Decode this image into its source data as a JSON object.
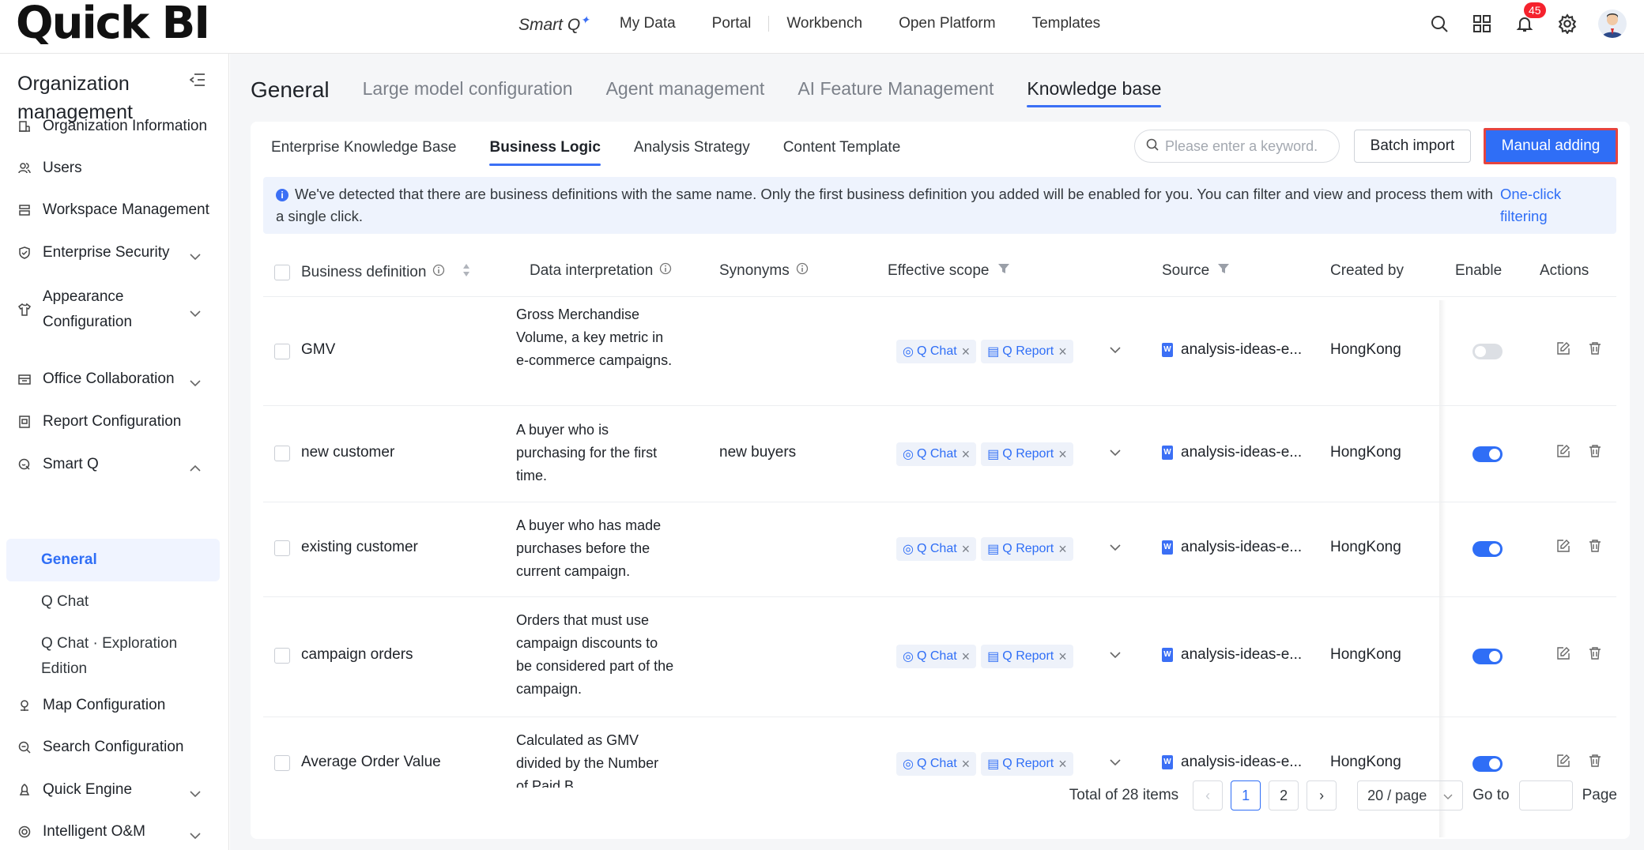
{
  "header": {
    "logo": "Quick BI",
    "smartq": "Smart Q",
    "nav": [
      "My Data",
      "Portal",
      "Workbench",
      "Open Platform",
      "Templates"
    ],
    "notification_count": "45"
  },
  "sidebar": {
    "title": "Organization management",
    "items": [
      {
        "label": "Organization Information",
        "icon": "org-icon"
      },
      {
        "label": "Users",
        "icon": "users-icon"
      },
      {
        "label": "Workspace Management",
        "icon": "workspace-icon"
      },
      {
        "label": "Enterprise Security",
        "icon": "shield-icon"
      },
      {
        "label": "Appearance Configuration",
        "icon": "shirt-icon"
      },
      {
        "label": "Office Collaboration",
        "icon": "office-icon"
      },
      {
        "label": "Report Configuration",
        "icon": "report-icon"
      },
      {
        "label": "Smart Q",
        "icon": "smartq-icon"
      },
      {
        "label": "Map Configuration",
        "icon": "map-icon"
      },
      {
        "label": "Search Configuration",
        "icon": "search-config-icon"
      },
      {
        "label": "Quick Engine",
        "icon": "engine-icon"
      },
      {
        "label": "Intelligent O&M",
        "icon": "om-icon"
      }
    ],
    "smartq_sub": [
      "General",
      "Q Chat",
      "Q Chat · Exploration Edition"
    ]
  },
  "main": {
    "tabs": [
      "General",
      "Large model configuration",
      "Agent management",
      "AI Feature Management",
      "Knowledge base"
    ],
    "active_tab": "Knowledge base",
    "subtabs": [
      "Enterprise Knowledge Base",
      "Business Logic",
      "Analysis Strategy",
      "Content Template"
    ],
    "active_subtab": "Business Logic",
    "search_placeholder": "Please enter a keyword.",
    "batch_import": "Batch import",
    "manual_adding": "Manual adding",
    "notice": "We've detected that there are business definitions with the same name. Only the first business definition you added will be enabled for you. You can filter and view and process them with a single click.",
    "notice_link": "One-click filtering",
    "columns": [
      "Business definition",
      "Data interpretation",
      "Synonyms",
      "Effective scope",
      "Source",
      "Created by",
      "Enable",
      "Actions"
    ],
    "rows": [
      {
        "name": "GMV",
        "interp": "Gross Merchandise Volume, a key metric in e-commerce campaigns.",
        "synonyms": "",
        "scope": [
          "Q Chat",
          "Q Report"
        ],
        "source": "analysis-ideas-e...",
        "created_by": "HongKong",
        "enabled": false
      },
      {
        "name": "new customer",
        "interp": "A buyer who is purchasing for the first time.",
        "synonyms": "new buyers",
        "scope": [
          "Q Chat",
          "Q Report"
        ],
        "source": "analysis-ideas-e...",
        "created_by": "HongKong",
        "enabled": true
      },
      {
        "name": "existing customer",
        "interp": "A buyer who has made purchases before the current campaign.",
        "synonyms": "",
        "scope": [
          "Q Chat",
          "Q Report"
        ],
        "source": "analysis-ideas-e...",
        "created_by": "HongKong",
        "enabled": true
      },
      {
        "name": "campaign orders",
        "interp": "Orders that must use campaign discounts to be considered part of the campaign.",
        "synonyms": "",
        "scope": [
          "Q Chat",
          "Q Report"
        ],
        "source": "analysis-ideas-e...",
        "created_by": "HongKong",
        "enabled": true
      },
      {
        "name": "Average Order Value",
        "interp": "Calculated as GMV divided by the Number of Paid B...",
        "synonyms": "",
        "scope": [
          "Q Chat",
          "Q Report"
        ],
        "source": "analysis-ideas-e...",
        "created_by": "HongKong",
        "enabled": true
      }
    ],
    "pagination": {
      "total": "Total of 28 items",
      "pages": [
        "1",
        "2"
      ],
      "current": "1",
      "page_size": "20 / page",
      "goto": "Go to",
      "page_label": "Page"
    }
  },
  "colors": {
    "accent": "#2f6ef6",
    "highlight_border": "#e5443f",
    "badge": "#f5222d"
  }
}
